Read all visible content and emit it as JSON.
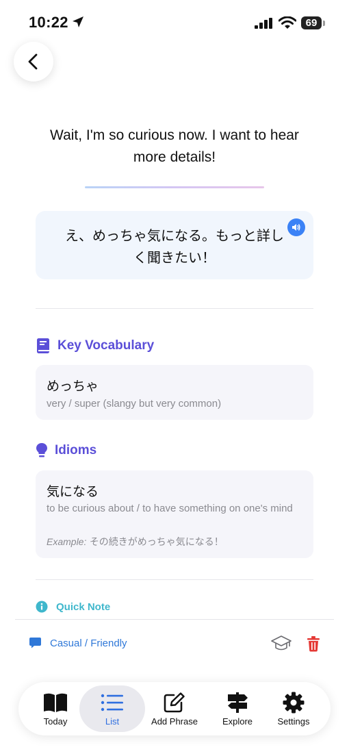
{
  "status_bar": {
    "time": "10:22",
    "battery": "69"
  },
  "phrase": {
    "english": "Wait, I'm so curious now. I want to hear more details!",
    "japanese": "え、めっちゃ気になる。もっと詳しく聞きたい！"
  },
  "vocabulary": {
    "title": "Key Vocabulary",
    "items": [
      {
        "term": "めっちゃ",
        "meaning": "very / super (slangy but very common)"
      }
    ]
  },
  "idioms": {
    "title": "Idioms",
    "items": [
      {
        "term": "気になる",
        "meaning": "to be curious about / to have something on one's mind",
        "example_label": "Example:",
        "example": "その続きがめっちゃ気になる！"
      }
    ]
  },
  "quick_note": {
    "title": "Quick Note"
  },
  "tone": {
    "label": "Casual / Friendly"
  },
  "tabs": [
    {
      "label": "Today",
      "icon": "book-open-icon"
    },
    {
      "label": "List",
      "icon": "list-icon",
      "active": true
    },
    {
      "label": "Add Phrase",
      "icon": "edit-icon"
    },
    {
      "label": "Explore",
      "icon": "signpost-icon"
    },
    {
      "label": "Settings",
      "icon": "gear-icon"
    }
  ],
  "colors": {
    "accent_blue": "#2f6fe0",
    "section_purple": "#5b4fd8",
    "note_teal": "#3fb7cc",
    "delete_red": "#e53935"
  }
}
